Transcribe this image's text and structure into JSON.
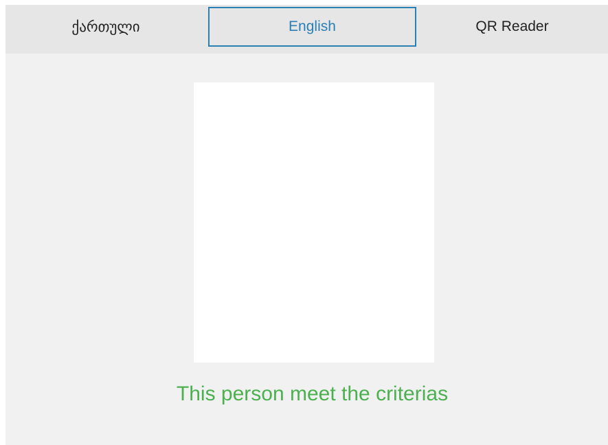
{
  "tabs": [
    {
      "label": "ქართული",
      "selected": false
    },
    {
      "label": "English",
      "selected": true
    },
    {
      "label": "QR Reader",
      "selected": false
    }
  ],
  "result": {
    "message": "This person meet the criterias",
    "color": "#4cb050"
  },
  "colors": {
    "accent": "#2a7fb4",
    "tabbar_bg": "#e6e6e6",
    "page_bg": "#f1f1f1"
  }
}
